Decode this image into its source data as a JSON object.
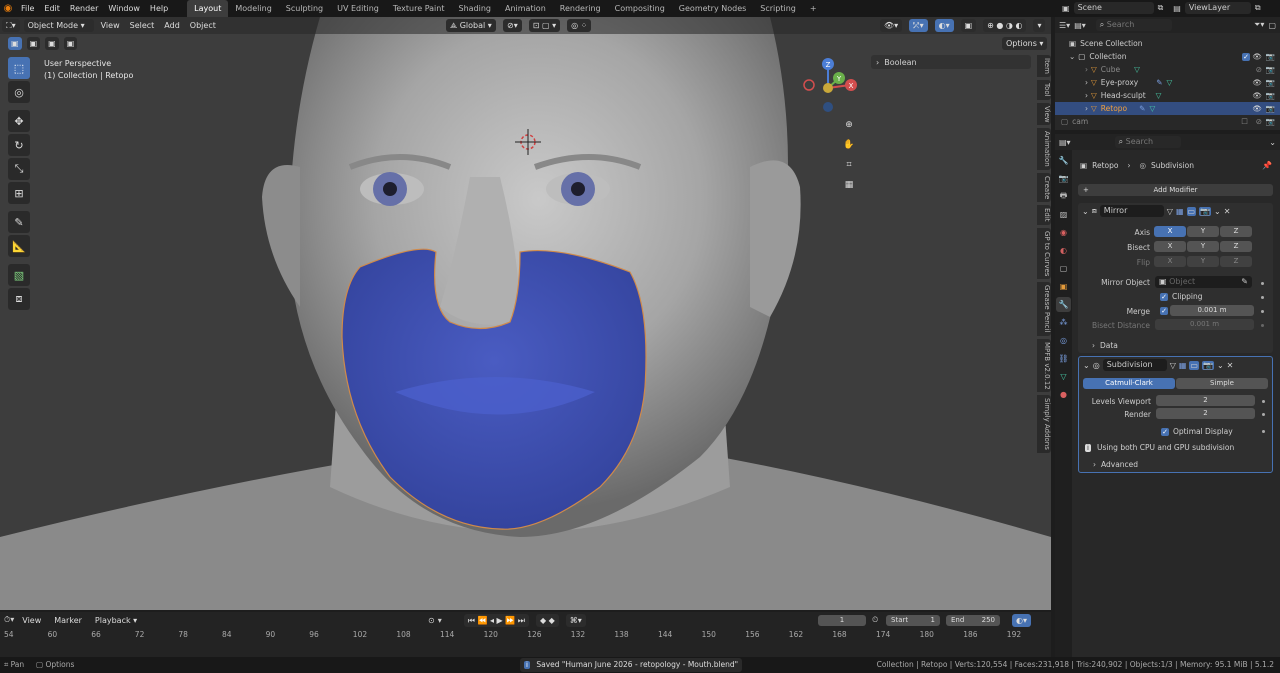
{
  "topbar": {
    "menus": [
      "File",
      "Edit",
      "Render",
      "Window",
      "Help"
    ],
    "workspaces": [
      "Layout",
      "Modeling",
      "Sculpting",
      "UV Editing",
      "Texture Paint",
      "Shading",
      "Animation",
      "Rendering",
      "Compositing",
      "Geometry Nodes",
      "Scripting"
    ],
    "active_workspace": "Layout",
    "add_tab": "+",
    "scene": "Scene",
    "view_layer": "ViewLayer"
  },
  "viewport": {
    "mode": "Object Mode",
    "menus": [
      "View",
      "Select",
      "Add",
      "Object"
    ],
    "transform_orientation": "Global",
    "options": "Options",
    "overlay_title": "User Perspective",
    "overlay_collection": "(1) Collection | Retopo",
    "boolean_panel": "Boolean",
    "side_tabs": [
      "Item",
      "Tool",
      "View",
      "Animation",
      "Create",
      "Edit",
      "GP to Curves",
      "Grease Pencil",
      "MPFB v2.0.12",
      "Simply Addons"
    ],
    "gizmo": {
      "x": "X",
      "y": "Y",
      "z": "Z"
    }
  },
  "outliner": {
    "search_placeholder": "Search",
    "scene_collection": "Scene Collection",
    "collection": "Collection",
    "items": [
      {
        "name": "Cube",
        "dim": true
      },
      {
        "name": "Eye-proxy",
        "dim": false
      },
      {
        "name": "Head-sculpt",
        "dim": false
      },
      {
        "name": "Retopo",
        "dim": false,
        "selected": true
      }
    ],
    "cam": "cam"
  },
  "properties": {
    "search_placeholder": "Search",
    "breadcrumb_object": "Retopo",
    "breadcrumb_modifier": "Subdivision",
    "add_modifier": "Add Modifier",
    "mirror": {
      "name": "Mirror",
      "axis_label": "Axis",
      "bisect_label": "Bisect",
      "flip_label": "Flip",
      "axes": [
        "X",
        "Y",
        "Z"
      ],
      "mirror_object_label": "Mirror Object",
      "mirror_object_placeholder": "Object",
      "clipping": "Clipping",
      "merge_label": "Merge",
      "merge_value": "0.001 m",
      "bisect_distance_label": "Bisect Distance",
      "bisect_distance_value": "0.001 m",
      "data": "Data"
    },
    "subdivision": {
      "name": "Subdivision",
      "catmull": "Catmull-Clark",
      "simple": "Simple",
      "levels_viewport_label": "Levels Viewport",
      "levels_viewport": "2",
      "render_label": "Render",
      "render": "2",
      "optimal_display": "Optimal Display",
      "info": "Using both CPU and GPU subdivision",
      "advanced": "Advanced"
    }
  },
  "timeline": {
    "menus": [
      "View",
      "Marker",
      "Playback"
    ],
    "current_frame": "1",
    "start_label": "Start",
    "start": "1",
    "end_label": "End",
    "end": "250",
    "ticks": [
      "54",
      "60",
      "66",
      "72",
      "78",
      "84",
      "90",
      "96",
      "102",
      "108",
      "114",
      "120",
      "126",
      "132",
      "138",
      "144",
      "150",
      "156",
      "162",
      "168",
      "174",
      "180",
      "186",
      "192"
    ]
  },
  "statusbar": {
    "pan": "Pan",
    "options": "Options",
    "saved": "Saved \"Human June 2026 - retopology - Mouth.blend\"",
    "stats": "Collection | Retopo | Verts:120,554 | Faces:231,918 | Tris:240,902 | Objects:1/3 | Memory: 95.1 MiB | 5.1.2"
  }
}
